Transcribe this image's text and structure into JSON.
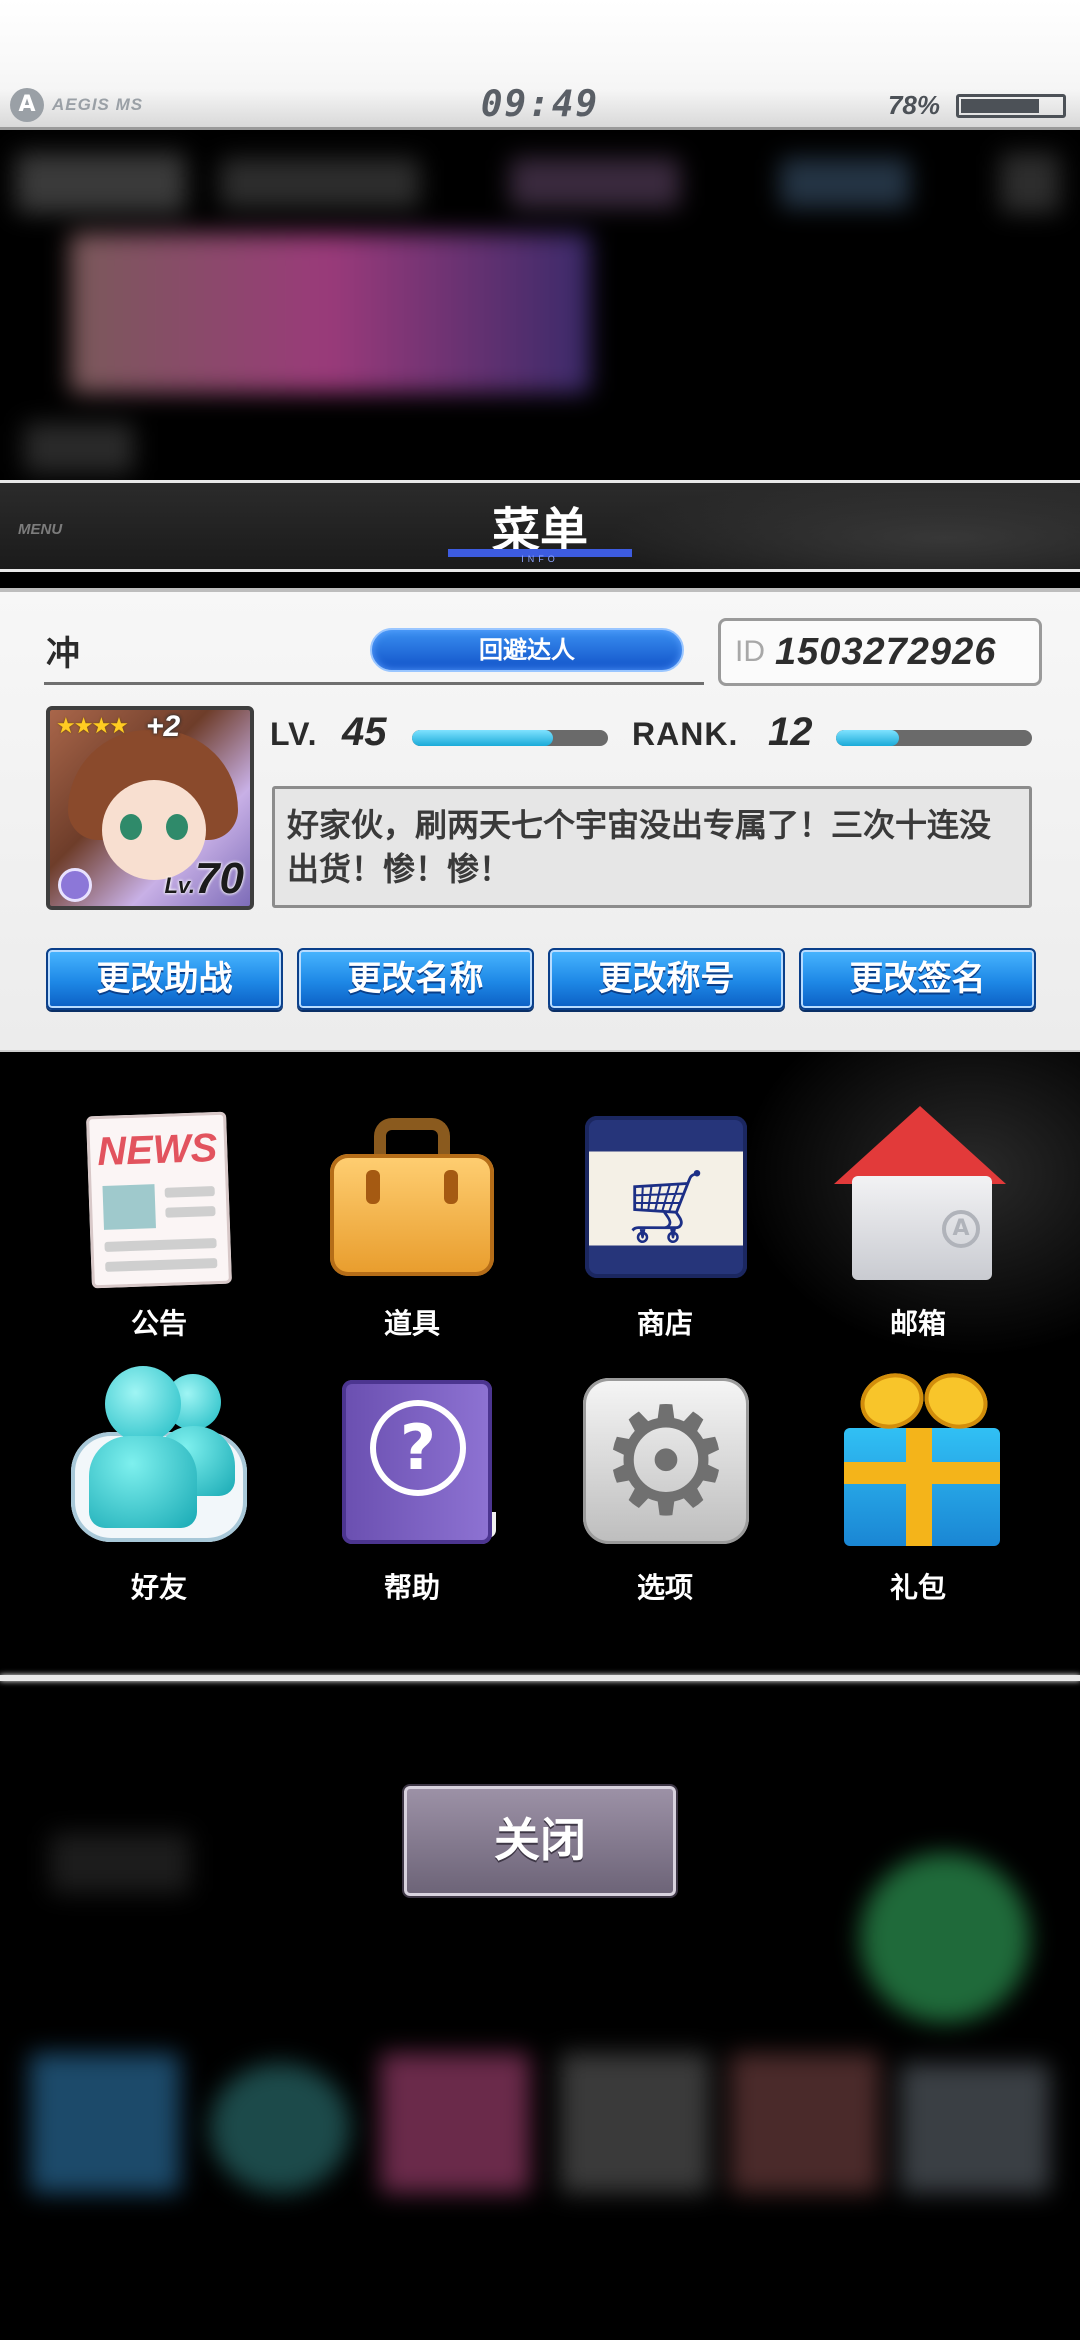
{
  "status_bar": {
    "brand": "AEGIS MS",
    "time": "09:49",
    "battery_text": "78%",
    "battery_level": 0.78
  },
  "menu_header": {
    "tag": "MENU",
    "title": "菜单",
    "subtitle": "INFO"
  },
  "profile": {
    "name": "冲",
    "title_badge": "回避达人",
    "id_label": "ID",
    "id_value": "1503272926",
    "avatar": {
      "stars": "★★★★",
      "plus": "+2",
      "level_prefix": "Lv.",
      "level": "70"
    },
    "lv_label": "LV.",
    "lv_value": "45",
    "lv_progress": 0.72,
    "rank_label": "RANK.",
    "rank_value": "12",
    "rank_progress": 0.32,
    "signature": "好家伙，刷两天七个宇宙没出专属了！三次十连没出货！惨！惨！",
    "buttons": [
      "更改助战",
      "更改名称",
      "更改称号",
      "更改签名"
    ]
  },
  "menu_items": [
    {
      "label": "公告",
      "icon": "news-icon"
    },
    {
      "label": "道具",
      "icon": "briefcase-icon"
    },
    {
      "label": "商店",
      "icon": "shopping-cart-icon"
    },
    {
      "label": "邮箱",
      "icon": "mailbox-icon"
    },
    {
      "label": "好友",
      "icon": "friends-icon"
    },
    {
      "label": "帮助",
      "icon": "help-book-icon"
    },
    {
      "label": "选项",
      "icon": "gear-icon"
    },
    {
      "label": "礼包",
      "icon": "gift-icon"
    }
  ],
  "news_icon_text": "NEWS",
  "close_label": "关闭",
  "colors": {
    "accent_blue": "#1e88e6",
    "header_underline": "#3d5ce0",
    "close_button": "#7f758a"
  }
}
